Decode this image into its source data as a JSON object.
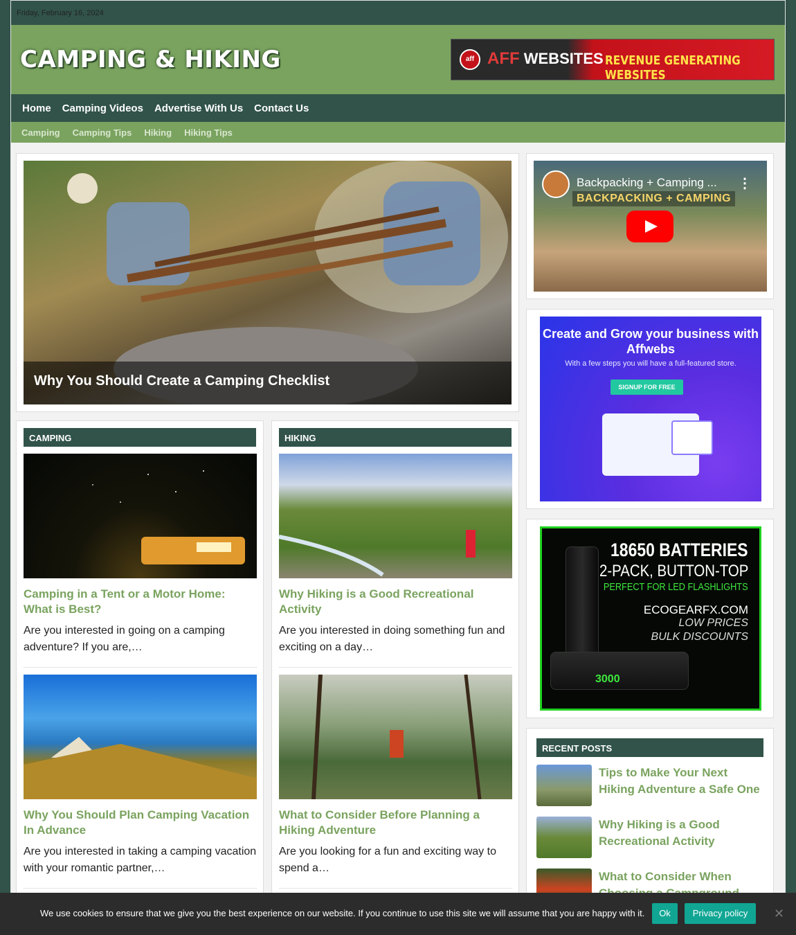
{
  "topbar": {
    "date": "Friday, February 16, 2024"
  },
  "header": {
    "logo": "CAMPING & HIKING",
    "ad": {
      "logo_glyph": "aff",
      "brand_a": "AFF",
      "brand_b": "WEBSITES",
      "tagline": "REVENUE GENERATING WEBSITES"
    }
  },
  "nav": {
    "items": [
      "Home",
      "Camping Videos",
      "Advertise With Us",
      "Contact Us"
    ]
  },
  "subnav": {
    "items": [
      "Camping",
      "Camping Tips",
      "Hiking",
      "Hiking Tips"
    ]
  },
  "featured": {
    "title": "Why You Should Create a Camping Checklist"
  },
  "camping": {
    "header": "CAMPING",
    "posts": [
      {
        "title": "Camping in a Tent or a Motor Home: What is Best?",
        "excerpt": "Are you interested in going on a camping adventure? If you are,…"
      },
      {
        "title": "Why You Should Plan Camping Vacation In Advance",
        "excerpt": "Are you interested in taking a camping vacation with your romantic partner,…"
      }
    ]
  },
  "hiking": {
    "header": "HIKING",
    "posts": [
      {
        "title": "Why Hiking is a Good Recreational Activity",
        "excerpt": "Are you interested in doing something fun and exciting on a day…"
      },
      {
        "title": "What to Consider Before Planning a Hiking Adventure",
        "excerpt": "Are you looking for a fun and exciting way to spend a…"
      }
    ]
  },
  "sidebar": {
    "video": {
      "title": "Backpacking + Camping ...",
      "badge": "BACKPACKING + CAMPING",
      "kebab": "⋮"
    },
    "ad2": {
      "headline": "Create and Grow your business with Affwebs",
      "sub": "With a few steps you will have a full-featured store.",
      "button": "SIGNUP FOR FREE"
    },
    "ad3": {
      "line1": "18650 BATTERIES",
      "line2": "2-PACK, BUTTON-TOP",
      "line3": "PERFECT FOR LED FLASHLIGHTS",
      "line4": "ECOGEARFX.COM",
      "line5": "LOW PRICES",
      "line6": "BULK DISCOUNTS",
      "battery_label": "3000"
    },
    "recent": {
      "header": "RECENT POSTS",
      "items": [
        {
          "title": "Tips to Make Your Next Hiking Adventure a Safe One"
        },
        {
          "title": "Why Hiking is a Good Recreational Activity"
        },
        {
          "title": "What to Consider When Choosing a Campground"
        }
      ]
    }
  },
  "cookie": {
    "text": "We use cookies to ensure that we give you the best experience on our website. If you continue to use this site we will assume that you are happy with it.",
    "ok": "Ok",
    "policy": "Privacy policy",
    "close": "✕"
  },
  "colors": {
    "brand_dark": "#315349",
    "brand_green": "#7aa35f",
    "accent_teal": "#11a694"
  }
}
